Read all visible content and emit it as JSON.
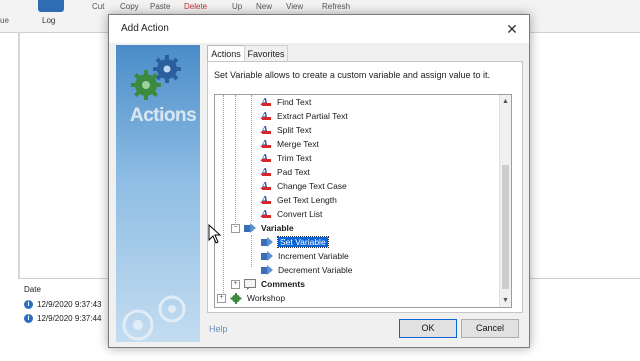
{
  "background_app": {
    "toolbar": {
      "left_fragment": "ue",
      "log_label": "Log",
      "cut": "Cut",
      "copy": "Copy",
      "paste": "Paste",
      "delete": "Delete",
      "up": "Up",
      "new": "New",
      "view": "View",
      "refresh": "Refresh"
    },
    "log_panel": {
      "column_header": "Date",
      "rows": [
        {
          "icon": "info-icon",
          "timestamp": "12/9/2020 9:37:43"
        },
        {
          "icon": "info-icon",
          "timestamp": "12/9/2020 9:37:44"
        }
      ]
    }
  },
  "dialog": {
    "title": "Add Action",
    "side_label": "Actions",
    "tabs": [
      {
        "label": "Actions",
        "active": true
      },
      {
        "label": "Favorites",
        "active": false
      }
    ],
    "description": "Set Variable allows to create a custom variable and assign value to it.",
    "tree": [
      {
        "label": "Find Text",
        "icon": "text-action-icon",
        "level": 2
      },
      {
        "label": "Extract Partial Text",
        "icon": "text-action-icon",
        "level": 2
      },
      {
        "label": "Split Text",
        "icon": "text-action-icon",
        "level": 2
      },
      {
        "label": "Merge Text",
        "icon": "text-action-icon",
        "level": 2
      },
      {
        "label": "Trim Text",
        "icon": "text-action-icon",
        "level": 2
      },
      {
        "label": "Pad Text",
        "icon": "text-action-icon",
        "level": 2
      },
      {
        "label": "Change Text Case",
        "icon": "text-action-icon",
        "level": 2
      },
      {
        "label": "Get Text Length",
        "icon": "text-action-icon",
        "level": 2
      },
      {
        "label": "Convert List",
        "icon": "text-action-icon",
        "level": 2
      },
      {
        "label": "Variable",
        "icon": "variable-icon",
        "level": 1,
        "expanded": true,
        "bold": true
      },
      {
        "label": "Set Variable",
        "icon": "variable-icon",
        "level": 2,
        "selected": true
      },
      {
        "label": "Increment Variable",
        "icon": "variable-icon",
        "level": 2
      },
      {
        "label": "Decrement Variable",
        "icon": "variable-icon",
        "level": 2
      },
      {
        "label": "Comments",
        "icon": "comment-icon",
        "level": 1,
        "expanded": false,
        "bold": true
      },
      {
        "label": "Workshop",
        "icon": "gear-icon",
        "level": 0,
        "expanded": false
      }
    ],
    "help_label": "Help",
    "ok_label": "OK",
    "cancel_label": "Cancel"
  },
  "colors": {
    "selection": "#0a64d8",
    "side_panel_top": "#4a8cc8",
    "text_icon_blue": "#2d55a8",
    "text_icon_red": "#d9262a"
  }
}
